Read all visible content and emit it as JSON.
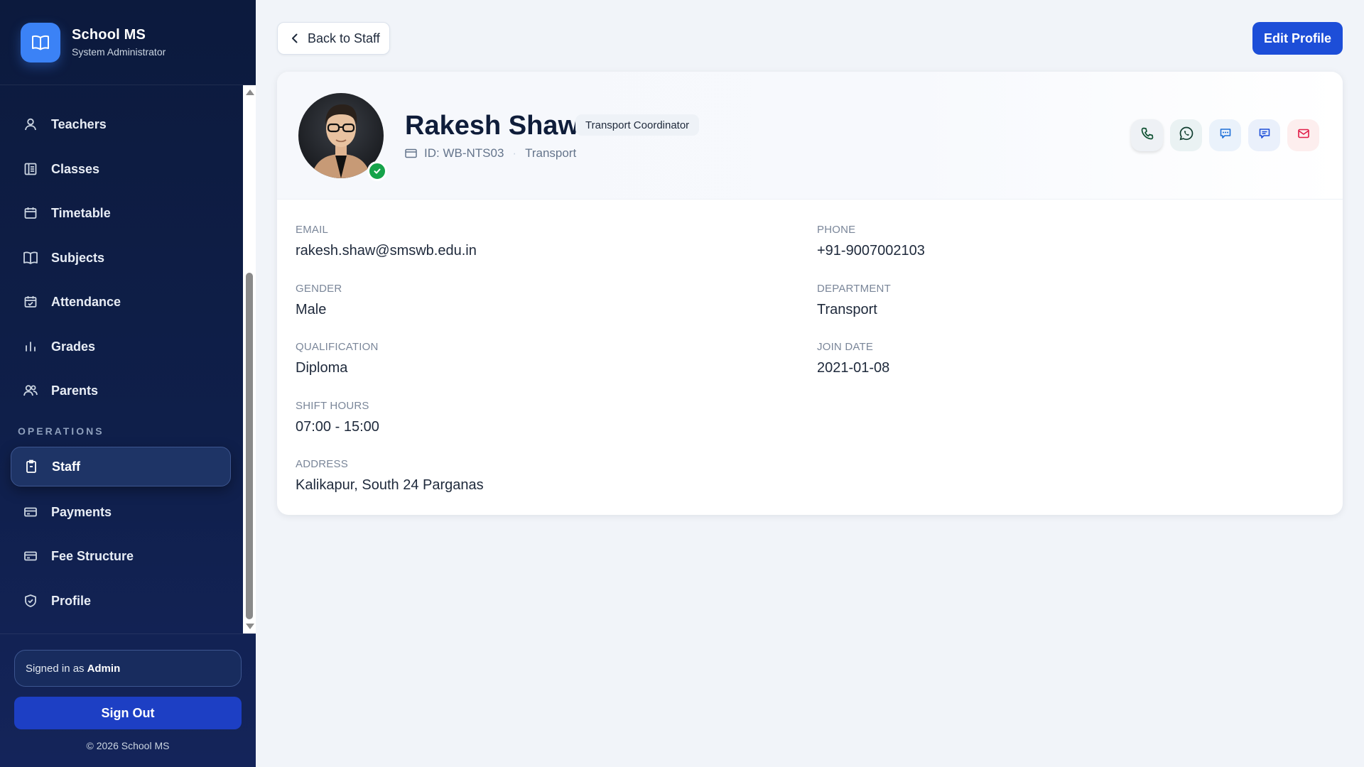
{
  "brand": {
    "name": "School MS",
    "role": "System Administrator"
  },
  "nav": {
    "items": [
      {
        "label": "Teachers",
        "icon": "user-icon"
      },
      {
        "label": "Classes",
        "icon": "layout-icon"
      },
      {
        "label": "Timetable",
        "icon": "calendar-icon"
      },
      {
        "label": "Subjects",
        "icon": "book-icon"
      },
      {
        "label": "Attendance",
        "icon": "calendar-check-icon"
      },
      {
        "label": "Grades",
        "icon": "bar-chart-icon"
      },
      {
        "label": "Parents",
        "icon": "users-icon"
      }
    ],
    "section_operations": "OPERATIONS",
    "operations": [
      {
        "label": "Staff",
        "icon": "badge-icon",
        "active": true
      },
      {
        "label": "Payments",
        "icon": "card-icon"
      },
      {
        "label": "Fee Structure",
        "icon": "card-icon"
      },
      {
        "label": "Profile",
        "icon": "shield-icon"
      }
    ]
  },
  "footer": {
    "signed_in_prefix": "Signed in as",
    "signed_in_user": "Admin",
    "sign_out": "Sign Out",
    "copyright": "© 2026 School MS"
  },
  "header": {
    "back_label": "Back to Staff",
    "edit_label": "Edit Profile"
  },
  "profile": {
    "name": "Rakesh Shaw",
    "role": "Transport Coordinator",
    "id": "ID: WB-NTS03",
    "department_tag": "Transport",
    "verified": true
  },
  "details": {
    "email": {
      "label": "EMAIL",
      "value": "rakesh.shaw@smswb.edu.in"
    },
    "phone": {
      "label": "PHONE",
      "value": "+91-9007002103"
    },
    "gender": {
      "label": "GENDER",
      "value": "Male"
    },
    "department": {
      "label": "DEPARTMENT",
      "value": "Transport"
    },
    "qualification": {
      "label": "QUALIFICATION",
      "value": "Diploma"
    },
    "join_date": {
      "label": "JOIN DATE",
      "value": "2021-01-08"
    },
    "shift_hours": {
      "label": "SHIFT HOURS",
      "value": "07:00 - 15:00"
    },
    "address": {
      "label": "ADDRESS",
      "value": "Kalikapur, South 24 Parganas"
    }
  },
  "colors": {
    "sidebar_bg": "#0f1f4a",
    "primary": "#1d4ed8",
    "verified": "#16a34a"
  }
}
